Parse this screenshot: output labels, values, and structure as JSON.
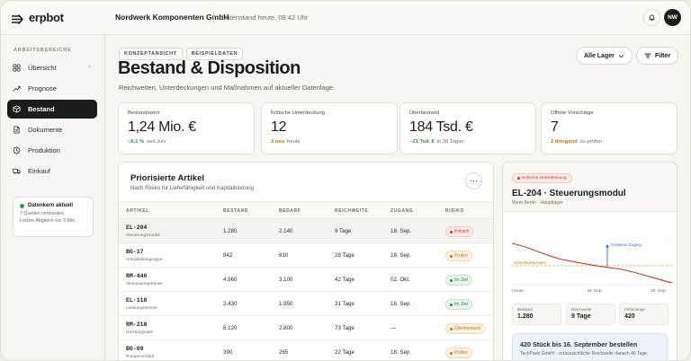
{
  "app": {
    "logo": "erpbot",
    "company": "Nordwerk Komponenten GmbH",
    "datestand": "Datenstand heute, 08:42 Uhr",
    "user_initials": "NW"
  },
  "sidebar": {
    "section": "ARBEITSBEREICHE",
    "items": [
      {
        "label": "Übersicht",
        "icon": "grid-icon"
      },
      {
        "label": "Prognose",
        "icon": "trend-icon"
      },
      {
        "label": "Bestand",
        "icon": "box-icon",
        "active": true
      },
      {
        "label": "Dokumente",
        "icon": "document-icon"
      },
      {
        "label": "Produktion",
        "icon": "clock-icon"
      },
      {
        "label": "Einkauf",
        "icon": "truck-icon"
      }
    ],
    "status": {
      "title": "Datenkern aktuell",
      "line1": "7 Quellen verbunden",
      "line2": "Letzter Abgleich vor 3 Min."
    }
  },
  "header": {
    "chips": [
      "KONZEPTANSICHT",
      "BEISPIELDATEN"
    ],
    "title": "Bestand & Disposition",
    "subtitle": "Reichweiten, Unterdeckungen und Maßnahmen auf aktueller Datenlage.",
    "lager_label": "Alle Lager",
    "filter_label": "Filter"
  },
  "kpis": [
    {
      "label": "Bestandswert",
      "value": "1,24 Mio. €",
      "delta": "−6,1 %",
      "delta_color": "green",
      "note": "seit Juni"
    },
    {
      "label": "Kritische Unterdeckung",
      "value": "12",
      "delta": "3 neu",
      "delta_color": "orange",
      "note": "heute"
    },
    {
      "label": "Überbestand",
      "value": "184 Tsd. €",
      "delta": "−21 Tsd. €",
      "delta_color": "green",
      "note": "in 30 Tagen"
    },
    {
      "label": "Offene Vorschläge",
      "value": "7",
      "delta": "2 dringend",
      "delta_color": "orange",
      "note": "zu prüfen"
    }
  ],
  "table": {
    "title": "Priorisierte Artikel",
    "subtitle": "Nach Risiko für Lieferfähigkeit und Kapitalbindung",
    "columns": [
      "ARTIKEL",
      "BESTAND",
      "BEDARF",
      "REICHWEITE",
      "ZUGANG",
      "RISIKO"
    ],
    "rows": [
      {
        "id": "EL-204",
        "name": "Steuerungsmodul",
        "bestand": "1.280",
        "bedarf": "2.140",
        "reichweite": "9 Tage",
        "zugang": "18. Sep.",
        "risiko": "Kritisch",
        "level": "red"
      },
      {
        "id": "BG-17",
        "name": "Antriebsbaugruppe",
        "bestand": "842",
        "bedarf": "610",
        "reichweite": "28 Tage",
        "zugang": "18. Sep.",
        "risiko": "Prüfen",
        "level": "orange"
      },
      {
        "id": "RM-440",
        "name": "Aluminiumgehäuse",
        "bestand": "4.960",
        "bedarf": "3.100",
        "reichweite": "42 Tage",
        "zugang": "02. Okt.",
        "risiko": "Im Ziel",
        "level": "green"
      },
      {
        "id": "EL-118",
        "name": "Leistungssensor",
        "bestand": "2.430",
        "bedarf": "1.950",
        "reichweite": "31 Tage",
        "zugang": "18. Sep.",
        "risiko": "Im Ziel",
        "level": "green"
      },
      {
        "id": "RM-218",
        "name": "Dichtungssatz",
        "bestand": "8.120",
        "bedarf": "2.800",
        "reichweite": "73 Tage",
        "zugang": "—",
        "risiko": "Überbestand",
        "level": "orange"
      },
      {
        "id": "BG-09",
        "name": "Pumpenmodul",
        "bestand": "390",
        "bedarf": "265",
        "reichweite": "22 Tage",
        "zugang": "18. Sep.",
        "risiko": "Prüfen",
        "level": "orange"
      }
    ]
  },
  "detail": {
    "pill": "Kritische Unterdeckung",
    "title": "EL-204 · Steuerungsmodul",
    "subtitle": "Werk Berlin · Hauptlager",
    "chart_labels": {
      "x_start": "Heute",
      "x_mid": "16. Sep.",
      "x_end": "30. Sep.",
      "safety": "Sicherheitsbestand",
      "inflow": "Geplanter Zugang"
    },
    "stats": [
      {
        "label": "Bestand",
        "value": "1.280"
      },
      {
        "label": "Reichweite",
        "value": "9 Tage"
      },
      {
        "label": "Fehlmenge",
        "value": "420"
      }
    ],
    "reco_title": "420 Stück bis 16. September bestellen",
    "reco_sub": "TechParts GmbH · voraussichtliche Reichweite danach 46 Tage.",
    "colors": {
      "critical": "#c0392b",
      "safety": "#d9a23b",
      "inflow": "#3b6fd9"
    }
  }
}
